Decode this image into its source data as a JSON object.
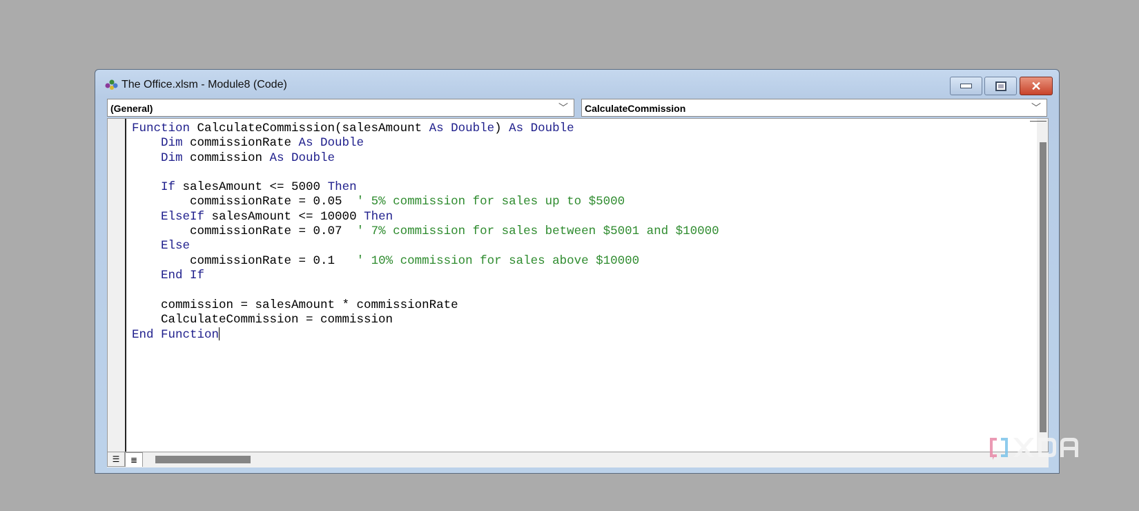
{
  "window": {
    "title": "The Office.xlsm - Module8 (Code)",
    "buttons": {
      "minimize": "minimize",
      "maximize": "maximize",
      "close": "close"
    }
  },
  "object_dropdown": {
    "value": "(General)"
  },
  "procedure_dropdown": {
    "value": "CalculateCommission"
  },
  "code": {
    "lines": [
      [
        {
          "t": "kw",
          "v": "Function "
        },
        {
          "t": "",
          "v": "CalculateCommission(salesAmount "
        },
        {
          "t": "kw",
          "v": "As Double"
        },
        {
          "t": "",
          "v": ") "
        },
        {
          "t": "kw",
          "v": "As Double"
        }
      ],
      [
        {
          "t": "kw",
          "v": "    Dim "
        },
        {
          "t": "",
          "v": "commissionRate "
        },
        {
          "t": "kw",
          "v": "As Double"
        }
      ],
      [
        {
          "t": "kw",
          "v": "    Dim "
        },
        {
          "t": "",
          "v": "commission "
        },
        {
          "t": "kw",
          "v": "As Double"
        }
      ],
      [],
      [
        {
          "t": "kw",
          "v": "    If "
        },
        {
          "t": "",
          "v": "salesAmount <= 5000 "
        },
        {
          "t": "kw",
          "v": "Then"
        }
      ],
      [
        {
          "t": "",
          "v": "        commissionRate = 0.05  "
        },
        {
          "t": "cm",
          "v": "' 5% commission for sales up to $5000"
        }
      ],
      [
        {
          "t": "kw",
          "v": "    ElseIf "
        },
        {
          "t": "",
          "v": "salesAmount <= 10000 "
        },
        {
          "t": "kw",
          "v": "Then"
        }
      ],
      [
        {
          "t": "",
          "v": "        commissionRate = 0.07  "
        },
        {
          "t": "cm",
          "v": "' 7% commission for sales between $5001 and $10000"
        }
      ],
      [
        {
          "t": "kw",
          "v": "    Else"
        }
      ],
      [
        {
          "t": "",
          "v": "        commissionRate = 0.1   "
        },
        {
          "t": "cm",
          "v": "' 10% commission for sales above $10000"
        }
      ],
      [
        {
          "t": "kw",
          "v": "    End If"
        }
      ],
      [],
      [
        {
          "t": "",
          "v": "    commission = salesAmount * commissionRate"
        }
      ],
      [
        {
          "t": "",
          "v": "    CalculateCommission = commission"
        }
      ],
      [
        {
          "t": "kw",
          "v": "End Function"
        }
      ]
    ]
  },
  "watermark": {
    "text": "XDA"
  },
  "colors": {
    "keyword": "#1f1f8c",
    "comment": "#2e8b2e",
    "background": "#ababab"
  }
}
